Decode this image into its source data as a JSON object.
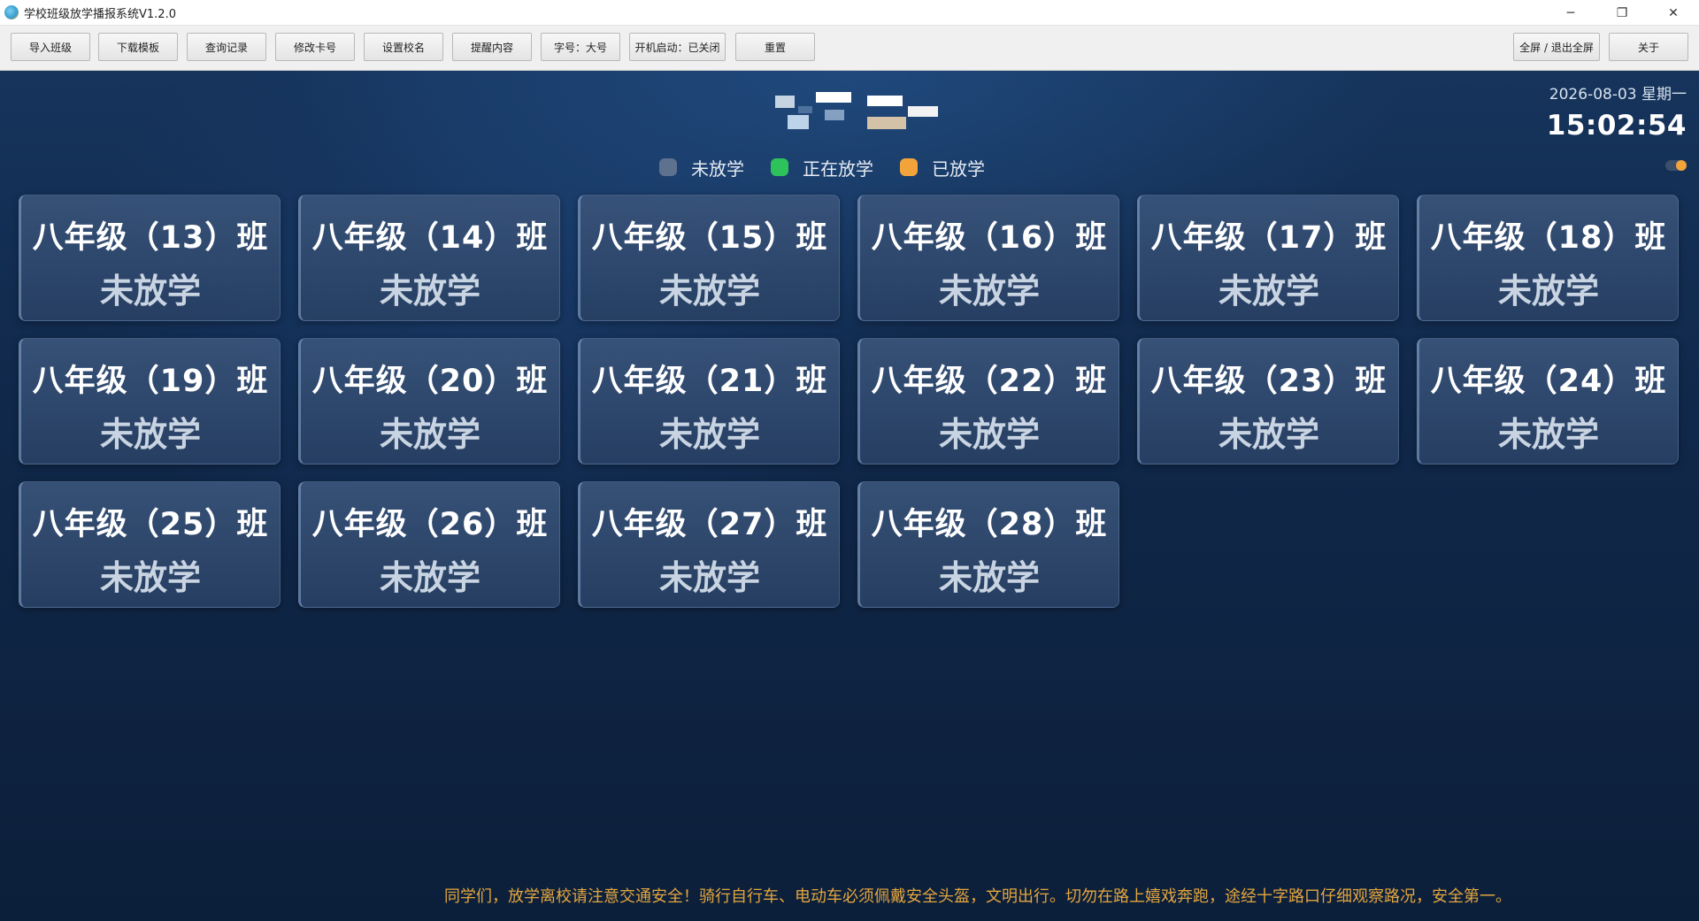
{
  "window": {
    "title": "学校班级放学播报系统V1.2.0",
    "controls": {
      "minimize": "─",
      "restore": "❐",
      "close": "✕"
    }
  },
  "toolbar": {
    "buttons": [
      {
        "label": "导入班级"
      },
      {
        "label": "下载模板"
      },
      {
        "label": "查询记录"
      },
      {
        "label": "修改卡号"
      },
      {
        "label": "设置校名"
      },
      {
        "label": "提醒内容"
      },
      {
        "label": "字号：大号"
      },
      {
        "label": "开机启动：已关闭"
      },
      {
        "label": "重置"
      }
    ],
    "fullscreen_label": "全屏 / 退出全屏",
    "about_label": "关于"
  },
  "header": {
    "date": "2026-08-03 星期一",
    "time": "15:02:54"
  },
  "legend": [
    {
      "label": "未放学",
      "color": "#5e7290"
    },
    {
      "label": "正在放学",
      "color": "#2ec25a"
    },
    {
      "label": "已放学",
      "color": "#f2a33a"
    }
  ],
  "classes": [
    {
      "name": "八年级（13）班",
      "status": "未放学"
    },
    {
      "name": "八年级（14）班",
      "status": "未放学"
    },
    {
      "name": "八年级（15）班",
      "status": "未放学"
    },
    {
      "name": "八年级（16）班",
      "status": "未放学"
    },
    {
      "name": "八年级（17）班",
      "status": "未放学"
    },
    {
      "name": "八年级（18）班",
      "status": "未放学"
    },
    {
      "name": "八年级（19）班",
      "status": "未放学"
    },
    {
      "name": "八年级（20）班",
      "status": "未放学"
    },
    {
      "name": "八年级（21）班",
      "status": "未放学"
    },
    {
      "name": "八年级（22）班",
      "status": "未放学"
    },
    {
      "name": "八年级（23）班",
      "status": "未放学"
    },
    {
      "name": "八年级（24）班",
      "status": "未放学"
    },
    {
      "name": "八年级（25）班",
      "status": "未放学"
    },
    {
      "name": "八年级（26）班",
      "status": "未放学"
    },
    {
      "name": "八年级（27）班",
      "status": "未放学"
    },
    {
      "name": "八年级（28）班",
      "status": "未放学"
    }
  ],
  "notice": "同学们，放学离校请注意交通安全！骑行自行车、电动车必须佩戴安全头盔，文明出行。切勿在路上嬉戏奔跑，途经十字路口仔细观察路况，安全第一。"
}
